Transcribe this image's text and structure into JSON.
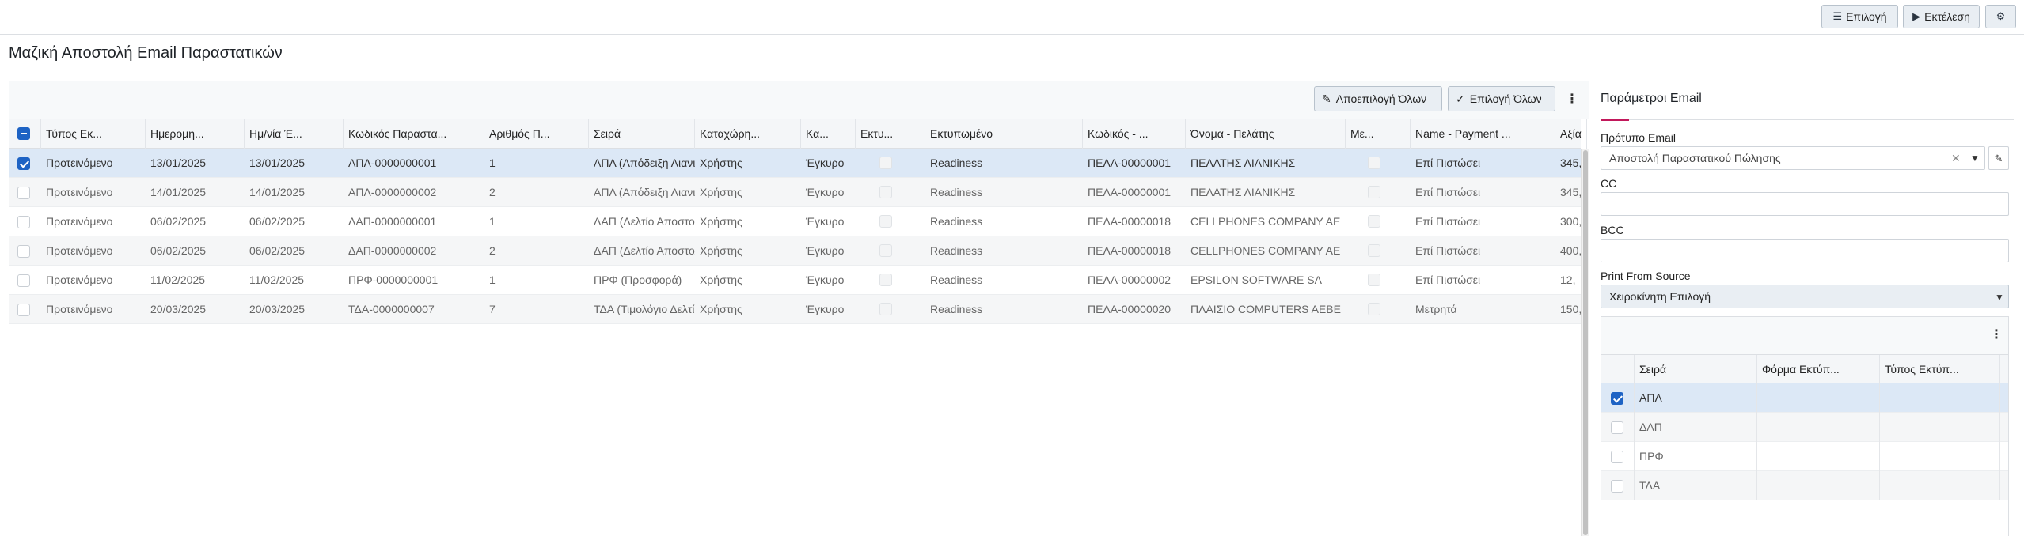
{
  "toolbar": {
    "select_label": "Επιλογή",
    "select_icon": "filter-list-icon",
    "execute_label": "Εκτέλεση",
    "execute_icon": "play-icon",
    "settings_icon": "gear-icon"
  },
  "page": {
    "title": "Μαζική Αποστολή Email Παραστατικών"
  },
  "grid": {
    "deselect_all_label": "Αποεπιλογή Όλων",
    "select_all_label": "Επιλογή Όλων",
    "columns": [
      "Τύπος Εκ...",
      "Ημερομη...",
      "Ημ/νία Έ...",
      "Κωδικός Παραστα...",
      "Αριθμός Π...",
      "Σειρά",
      "Καταχώρη...",
      "Κα...",
      "Εκτυ...",
      "Εκτυπωμένο",
      "Κωδικός - ...",
      "Όνομα - Πελάτης",
      "Με...",
      "Name - Payment ...",
      "Αξία"
    ],
    "rows": [
      {
        "selected": true,
        "cells": [
          "Προτεινόμενο",
          "13/01/2025",
          "13/01/2025",
          "ΑΠΛ-0000000001",
          "1",
          "ΑΠΛ (Απόδειξη Λιανικής)",
          "Χρήστης",
          "Έγκυρο",
          "",
          "Readiness",
          "ΠΕΛΑ-00000001",
          "ΠΕΛΑΤΗΣ ΛΙΑΝΙΚΗΣ",
          "",
          "Επί Πιστώσει",
          "345,"
        ]
      },
      {
        "selected": false,
        "cells": [
          "Προτεινόμενο",
          "14/01/2025",
          "14/01/2025",
          "ΑΠΛ-0000000002",
          "2",
          "ΑΠΛ (Απόδειξη Λιανικής)",
          "Χρήστης",
          "Έγκυρο",
          "",
          "Readiness",
          "ΠΕΛΑ-00000001",
          "ΠΕΛΑΤΗΣ ΛΙΑΝΙΚΗΣ",
          "",
          "Επί Πιστώσει",
          "345,"
        ]
      },
      {
        "selected": false,
        "cells": [
          "Προτεινόμενο",
          "06/02/2025",
          "06/02/2025",
          "ΔΑΠ-0000000001",
          "1",
          "ΔΑΠ (Δελτίο Αποστολής)",
          "Χρήστης",
          "Έγκυρο",
          "",
          "Readiness",
          "ΠΕΛΑ-00000018",
          "CELLPHONES COMPANY AE",
          "",
          "Επί Πιστώσει",
          "300,"
        ]
      },
      {
        "selected": false,
        "cells": [
          "Προτεινόμενο",
          "06/02/2025",
          "06/02/2025",
          "ΔΑΠ-0000000002",
          "2",
          "ΔΑΠ (Δελτίο Αποστολής)",
          "Χρήστης",
          "Έγκυρο",
          "",
          "Readiness",
          "ΠΕΛΑ-00000018",
          "CELLPHONES COMPANY AE",
          "",
          "Επί Πιστώσει",
          "400,"
        ]
      },
      {
        "selected": false,
        "cells": [
          "Προτεινόμενο",
          "11/02/2025",
          "11/02/2025",
          "ΠΡΦ-0000000001",
          "1",
          "ΠΡΦ (Προσφορά)",
          "Χρήστης",
          "Έγκυρο",
          "",
          "Readiness",
          "ΠΕΛΑ-00000002",
          "EPSILON SOFTWARE SA",
          "",
          "Επί Πιστώσει",
          "12,"
        ]
      },
      {
        "selected": false,
        "cells": [
          "Προτεινόμενο",
          "20/03/2025",
          "20/03/2025",
          "ΤΔΑ-0000000007",
          "7",
          "ΤΔΑ (Τιμολόγιο Δελτίο Αποστολής)",
          "Χρήστης",
          "Έγκυρο",
          "",
          "Readiness",
          "ΠΕΛΑ-00000020",
          "ΠΛΑΙΣΙΟ COMPUTERS AEBE",
          "",
          "Μετρητά",
          "150,"
        ]
      }
    ]
  },
  "email_params": {
    "title": "Παράμετροι Email",
    "template_label": "Πρότυπο Email",
    "template_value": "Αποστολή Παραστατικού Πώλησης",
    "cc_label": "CC",
    "cc_value": "",
    "bcc_label": "BCC",
    "bcc_value": "",
    "print_source_label": "Print From Source",
    "print_source_value": "Χειροκίνητη Επιλογή",
    "series_grid": {
      "columns": [
        "Σειρά",
        "Φόρμα Εκτύπ...",
        "Τύπος Εκτύπ..."
      ],
      "rows": [
        {
          "selected": true,
          "series": "ΑΠΛ",
          "form": "",
          "type": ""
        },
        {
          "selected": false,
          "series": "ΔΑΠ",
          "form": "",
          "type": ""
        },
        {
          "selected": false,
          "series": "ΠΡΦ",
          "form": "",
          "type": ""
        },
        {
          "selected": false,
          "series": "ΤΔΑ",
          "form": "",
          "type": ""
        }
      ]
    }
  },
  "colors": {
    "accent": "#1e63c4",
    "tab_underline": "#c2185b",
    "selected_row": "#dce8f6",
    "button_bg": "#e9eef3"
  }
}
